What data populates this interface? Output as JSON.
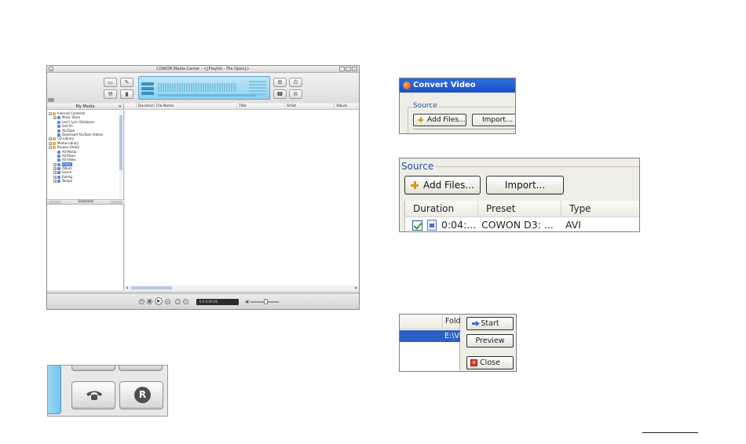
{
  "main_window": {
    "title": "COWON Media Center - <[Playlist - File Open]>",
    "left_pane": {
      "header": "My Media",
      "tree": [
        {
          "label": "Internet Contents",
          "level": 0,
          "exp": "-"
        },
        {
          "label": "Music Store",
          "level": 1,
          "exp": "+"
        },
        {
          "label": "Leo's Lyric Database",
          "level": 1,
          "exp": ""
        },
        {
          "label": "last.fm",
          "level": 1,
          "exp": ""
        },
        {
          "label": "YouTube",
          "level": 1,
          "exp": ""
        },
        {
          "label": "Download YouTube Videos",
          "level": 1,
          "exp": ""
        },
        {
          "label": "CD Library",
          "level": 0,
          "exp": "+"
        },
        {
          "label": "Media Library",
          "level": 0,
          "exp": "+"
        },
        {
          "label": "Browse (Auto)",
          "level": 0,
          "exp": "-"
        },
        {
          "label": "All Media",
          "level": 1,
          "exp": ""
        },
        {
          "label": "All Music",
          "level": 1,
          "exp": ""
        },
        {
          "label": "All Video",
          "level": 1,
          "exp": ""
        },
        {
          "label": "Artist",
          "level": 1,
          "exp": "+",
          "selected": true
        },
        {
          "label": "Album",
          "level": 1,
          "exp": "+"
        },
        {
          "label": "Genre",
          "level": 1,
          "exp": "+"
        },
        {
          "label": "Rating",
          "level": 1,
          "exp": "+"
        },
        {
          "label": "Tempo",
          "level": 1,
          "exp": "+"
        }
      ],
      "footer_label": "Selected"
    },
    "columns": [
      "Duration",
      "File Name",
      "Title",
      "Artist",
      "Album"
    ],
    "transport": {
      "time": "0    0    0:00:00"
    }
  },
  "convert_window": {
    "title": "Convert Video",
    "group_label": "Source",
    "add_files_label": "Add Files...",
    "import_label": "Import..."
  },
  "source_panel": {
    "group_label": "Source",
    "add_files_label": "Add Files...",
    "import_label": "Import...",
    "columns": [
      "Duration",
      "Preset",
      "Type"
    ],
    "rows": [
      {
        "duration": "0:04:...",
        "preset": "COWON D3: ...",
        "type": "AVI"
      }
    ]
  },
  "action_panel": {
    "column_label": "Fold",
    "selected_row": "E:\\Vi",
    "start_label": "Start",
    "preview_label": "Preview",
    "close_label": "Close"
  },
  "colors": {
    "xp_title_blue": "#2f6fe0",
    "xp_group_label": "#1f4fa8",
    "selection_blue": "#2c5fc3",
    "lcd_blue": "#8fd0ee"
  }
}
